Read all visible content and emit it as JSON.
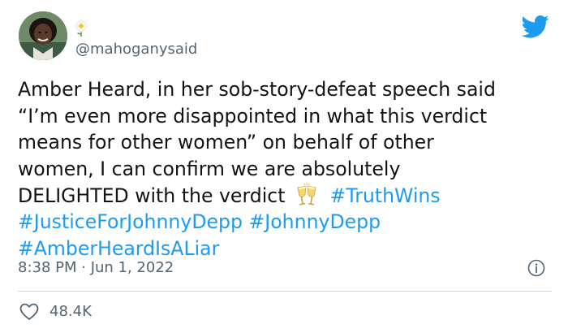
{
  "tweet": {
    "handle": "@mahoganysaid",
    "lines": [
      "Amber Heard, in her sob-story-defeat speech said",
      "“I’m even more disappointed in what this verdict",
      "means for other women” on behalf of other",
      "women, I can confirm we are absolutely"
    ],
    "line5_text": "DELIGHTED with the verdict",
    "hashtags": [
      "#TruthWins",
      "#JusticeForJohnnyDepp",
      "#JohnnyDepp",
      "#AmberHeardIsALiar"
    ],
    "timestamp": "8:38 PM · Jun 1, 2022",
    "like_count": "48.4K"
  },
  "icons": {
    "name_emoji": "daisy-flower",
    "text_emoji": "clinking-glasses",
    "brand": "twitter-bird",
    "info": "info-circle",
    "like": "heart-outline"
  },
  "colors": {
    "text": "#0f1419",
    "secondary": "#536471",
    "link": "#1d9bf0",
    "divider": "#cfd9de"
  }
}
